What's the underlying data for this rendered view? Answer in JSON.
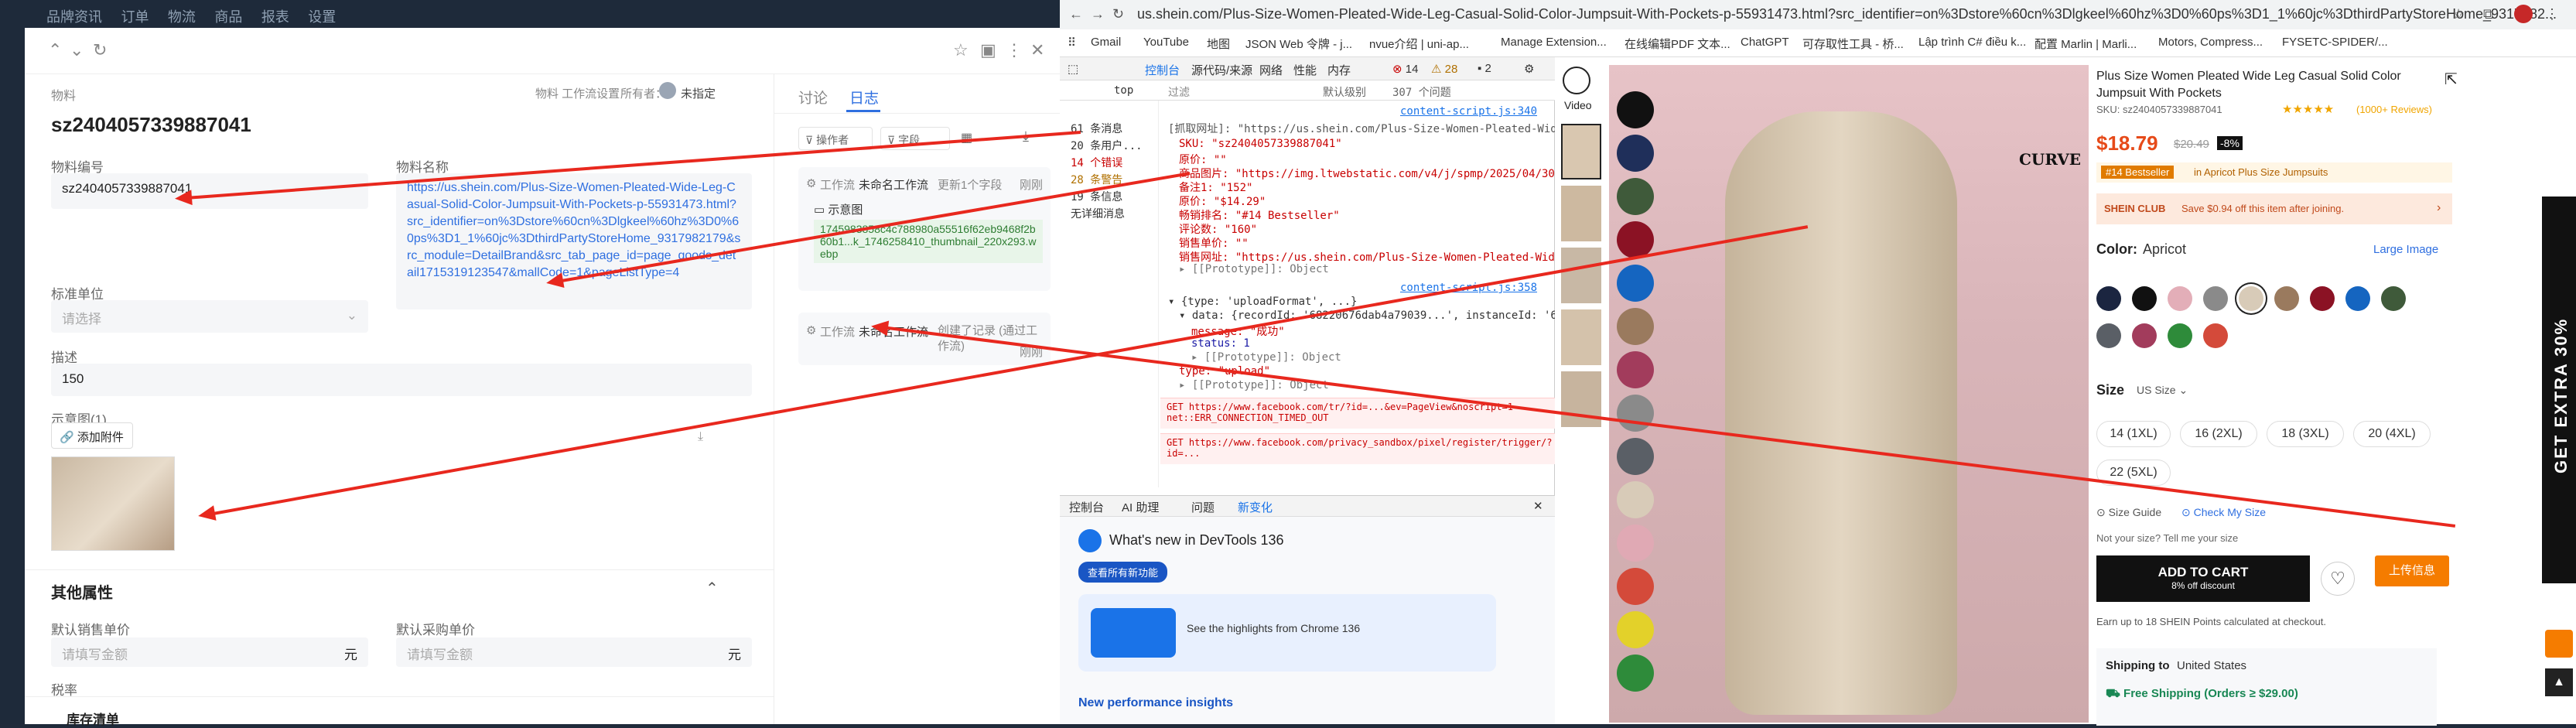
{
  "left_strip": {
    "items": [
      "品牌资讯",
      "订单",
      "物流",
      "商品",
      "报表",
      "设置"
    ]
  },
  "left_panel": {
    "breadcrumb": "物料",
    "header_actions": {
      "link": "物料 工作流设置",
      "owner_label": "所有者：",
      "owner_value": "未指定"
    },
    "title": "sz2404057339887041",
    "fields": {
      "code_label": "物料编号",
      "code_value": "sz2404057339887041",
      "name_label": "物料名称",
      "name_value": "https://us.shein.com/Plus-Size-Women-Pleated-Wide-Leg-Casual-Solid-Color-Jumpsuit-With-Pockets-p-55931473.html?src_identifier=on%3Dstore%60cn%3Dlgkeel%60hz%3D0%60ps%3D1_1%60jc%3DthirdPartyStoreHome_9317982179&src_module=DetailBrand&src_tab_page_id=page_goods_detail1715319123547&mallCode=1&pageListType=4",
      "unit_label": "标准单位",
      "unit_placeholder": "请选择",
      "desc_label": "描述",
      "desc_value": "150",
      "image_label": "示意图(1)",
      "add_attachment": "添加附件"
    },
    "other_props": {
      "title": "其他属性",
      "sale_price_label": "默认销售单价",
      "sale_price_placeholder": "请填写金额",
      "purchase_price_label": "默认采购单价",
      "purchase_price_placeholder": "请填写金额",
      "currency": "元",
      "tax_label": "税率",
      "inventory_label": "库存清单"
    },
    "tabs": [
      "讨论",
      "日志"
    ],
    "log_toolbar": {
      "action": "操作者",
      "field": "字段"
    },
    "logs": [
      {
        "type": "工作流",
        "name": "未命名工作流",
        "action": "更新1个字段",
        "time": "刚刚",
        "field": "示意图",
        "file": "1745983858c4c788980a55516f62eb9468f2b60b1...k_1746258410_thumbnail_220x293.webp"
      },
      {
        "type": "工作流",
        "name": "未命名工作流",
        "action": "创建了记录 (通过工作流)",
        "time": "刚刚"
      }
    ]
  },
  "browser": {
    "url": "us.shein.com/Plus-Size-Women-Pleated-Wide-Leg-Casual-Solid-Color-Jumpsuit-With-Pockets-p-55931473.html?src_identifier=on%3Dstore%60cn%3Dlgkeel%60hz%3D0%60ps%3D1_1%60jc%3DthirdPartyStoreHome_9317982...",
    "bookmarks": [
      "Gmail",
      "YouTube",
      "地图",
      "JSON Web 令牌 - j...",
      "nvue介绍 | uni-ap...",
      "Manage Extension...",
      "在线编辑PDF 文本...",
      "ChatGPT",
      "可存取性工具 - 桥...",
      "Lập trình C# điều k...",
      "配置 Marlin | Marli...",
      "Motors, Compress...",
      "FYSETC-SPIDER/..."
    ]
  },
  "devtools": {
    "tabs": [
      "控制台",
      "源代码/来源",
      "网络",
      "性能",
      "内存"
    ],
    "top_label": "top",
    "filter_label": "过滤",
    "level_label": "默认级别",
    "issues": "307 个问题",
    "counts": {
      "errors": "14",
      "warnings": "28",
      "info": "2"
    },
    "sidebar": [
      "61 条消息",
      "20 条用户...",
      "14 个错误",
      "28 条警告",
      "19 条信息",
      "无详细消息"
    ],
    "lines": [
      "[抓取网址]: \"https://us.shein.com/Plus-Size-Women-Pleated-Wide-...src_ide\"",
      "SKU: \"sz2404057339887041\"",
      "原价: \"\"",
      "商品图片: \"https://img.ltwebstatic.com/v4/j/spmp/2025/04/30/e2/1745...\"",
      "备注1: \"152\"",
      "原价: \"$14.29\"",
      "畅销排名: \"#14 Bestseller\"",
      "评论数: \"160\"",
      "销售单价: \"\"",
      "销售网址: \"https://us.shein.com/Plus-Size-Women-Pleated-Wide-Leg-Cas\"",
      "▸ [[Prototype]]: Object",
      "▾ {type: 'uploadFormat', ...}",
      "▾ data: {recordId: '68220676dab4a79039...', instanceId: '6822067...'}",
      "message: \"成功\"",
      "status: 1",
      "▸ [[Prototype]]: Object",
      "type: \"upload\"",
      "▸ [[Prototype]]: Object"
    ],
    "links": [
      "content-script.js:340",
      "content-script.js:358"
    ],
    "errors": [
      "GET https://www.facebook.com/tr/?id=...&ev=PageView&noscript=1 net::ERR_CONNECTION_TIMED_OUT",
      "GET https://www.facebook.com/privacy_sandbox/pixel/register/trigger/?id=..."
    ],
    "drawer_tabs": [
      "控制台",
      "AI 助理",
      "问题",
      "新变化"
    ],
    "whats_new": "What's new in DevTools 136",
    "whats_new_btn": "查看所有新功能",
    "highlights": "See the highlights from Chrome 136",
    "perf": "New performance insights"
  },
  "product": {
    "video_label": "Video",
    "title": "Plus Size Women Pleated Wide Leg Casual Solid Color Jumpsuit With Pockets",
    "sku": "SKU: sz2404057339887041",
    "reviews": "(1000+ Reviews)",
    "price": "$18.79",
    "old_price": "$20.49",
    "discount": "-8%",
    "bestseller": "#14 Bestseller",
    "bestseller_cat": "in Apricot Plus Size Jumpsuits",
    "club": "SHEIN CLUB",
    "club_text": "Save $0.94 off this item after joining.",
    "color_label": "Color:",
    "color_value": "Apricot",
    "large_image": "Large Image",
    "size_label": "Size",
    "size_unit": "US Size",
    "sizes": [
      "14 (1XL)",
      "16 (2XL)",
      "18 (3XL)",
      "20 (4XL)",
      "22 (5XL)"
    ],
    "size_guide": "Size Guide",
    "check_size": "Check My Size",
    "not_size": "Not your size? Tell me your size",
    "add_to_cart": "ADD TO CART",
    "cart_sub": "8% off discount",
    "upload_btn": "上传信息",
    "points": "Earn up to 18 SHEIN Points calculated at checkout.",
    "shipping": "Shipping to",
    "shipping_to": "United States",
    "free_ship": "Free Shipping (Orders ≥ $29.00)",
    "side_banner": "GET EXTRA 30%",
    "curve": "CURVE"
  }
}
